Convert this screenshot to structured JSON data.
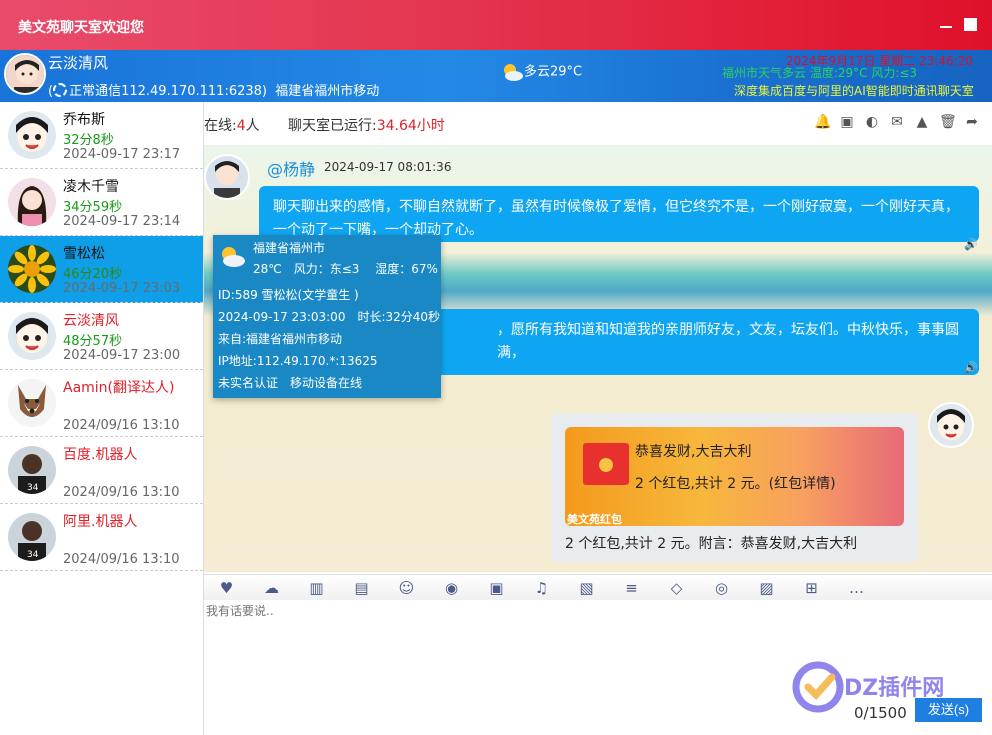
{
  "window": {
    "title": "美文苑聊天室欢迎您"
  },
  "header": {
    "username": "云淡清风",
    "connection": "正常通信112.49.170.111:6238)",
    "location": "福建省福州市移动",
    "weather": "多云29°C",
    "datetime": "2024年9月17日 星期二 23:46:20",
    "ticker1": "福州市天气多云 温度:29°C 风力:≤3",
    "ticker2": "深度集成百度与阿里的AI智能即时通讯聊天室"
  },
  "status": {
    "online_label": "在线:",
    "online_count": "4",
    "online_unit": "人",
    "uptime_label": "聊天室已运行:",
    "uptime_value": "34.64小时"
  },
  "users": [
    {
      "name": "乔布斯",
      "duration": "32分8秒",
      "time": "2024-09-17 23:17"
    },
    {
      "name": "凌木千雪",
      "duration": "34分59秒",
      "time": "2024-09-17 23:14"
    },
    {
      "name": "雪松松",
      "duration": "46分20秒",
      "time": "2024-09-17 23:03"
    },
    {
      "name": "云淡清风",
      "duration": "48分57秒",
      "time": "2024-09-17 23:00"
    },
    {
      "name": "Aamin(翻译达人)",
      "duration": "",
      "time": "2024/09/16 13:10"
    },
    {
      "name": "百度.机器人",
      "duration": "",
      "time": "2024/09/16 13:10"
    },
    {
      "name": "阿里.机器人",
      "duration": "",
      "time": "2024/09/16 13:10"
    }
  ],
  "messages": [
    {
      "sender": "@杨静",
      "time": "2024-09-17 08:01:36",
      "text": "聊天聊出来的感情，不聊自然就断了，虽然有时候像极了爱情，但它终究不是，一个刚好寂寞，一个刚好天真，一个动了一下嘴，一个却动了心。"
    },
    {
      "text": "，愿所有我知道和知道我的亲朋师好友，文友，坛友们。中秋快乐，事事圆满，"
    }
  ],
  "popup": {
    "location": "福建省福州市",
    "weather": "28℃　风力：东≤3　 湿度：67%",
    "id_line": "ID:589  雪松松(文学童生 )",
    "login_line": "2024-09-17 23:03:00　时长:32分40秒",
    "from_line": "来自:福建省福州市移动",
    "ip_line": "IP地址:112.49.170.*:13625",
    "status_line": "未实名认证　移动设备在线"
  },
  "redpacket": {
    "title": "恭喜发财,大吉大利",
    "summary": "2 个红包,共计 2 元。(红包详情)",
    "brand": "美文苑红包",
    "footer": "2 个红包,共计 2 元。附言：恭喜发财,大吉大利"
  },
  "input": {
    "placeholder": "我有话要说..",
    "counter": "0/1500",
    "send_label": "发送(s)"
  },
  "watermark": {
    "text": "DZ插件网"
  },
  "colors": {
    "title_bar": "#e4354f",
    "info_bar": "#2389e6",
    "accent_blue": "#0ea6f2",
    "selected": "#0f9ee8",
    "red": "#e0202a"
  }
}
